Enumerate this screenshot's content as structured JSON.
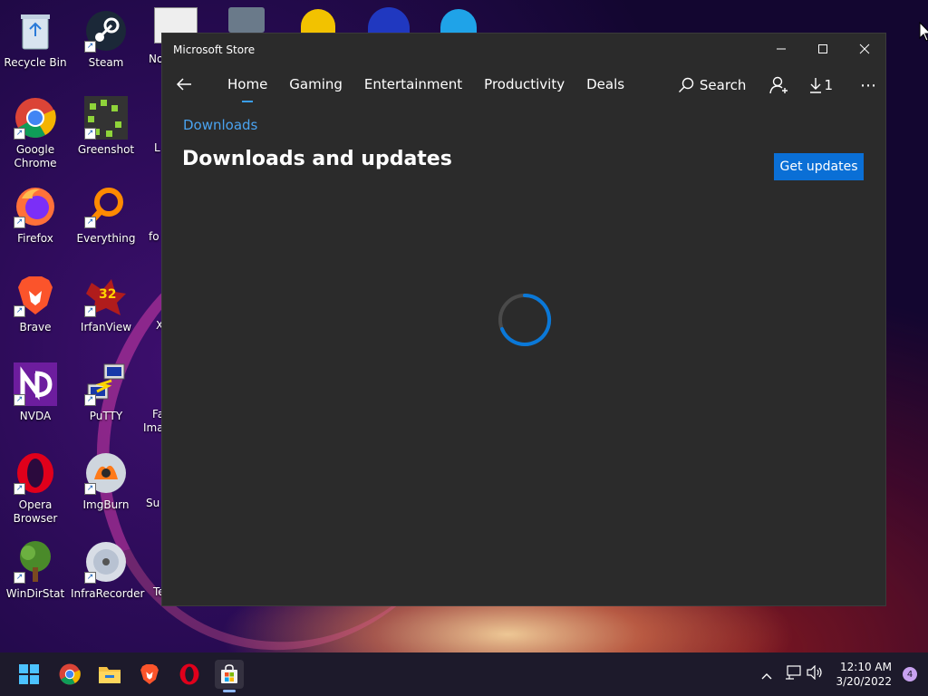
{
  "desktop": {
    "icons": [
      {
        "label": "Recycle Bin"
      },
      {
        "label": "Steam"
      },
      {
        "label": "Google Chrome"
      },
      {
        "label": "Greenshot"
      },
      {
        "label": "Firefox"
      },
      {
        "label": "Everything"
      },
      {
        "label": "Brave"
      },
      {
        "label": "IrfanView"
      },
      {
        "label": "NVDA"
      },
      {
        "label": "PuTTY"
      },
      {
        "label": "Opera Browser"
      },
      {
        "label": "ImgBurn"
      },
      {
        "label": "WinDirStat"
      },
      {
        "label": "InfraRecorder"
      }
    ],
    "partial_labels": [
      "No",
      "L",
      "fo",
      "X",
      "Fa",
      "Ima",
      "Su",
      "Te"
    ],
    "irfanview_badge": "32"
  },
  "window": {
    "title": "Microsoft Store",
    "controls": {
      "minimize": "—",
      "maximize": "☐",
      "close": "✕"
    },
    "nav": {
      "back": "←",
      "tabs": [
        {
          "label": "Home",
          "active": true
        },
        {
          "label": "Gaming"
        },
        {
          "label": "Entertainment"
        },
        {
          "label": "Productivity"
        },
        {
          "label": "Deals"
        }
      ],
      "search_label": "Search",
      "downloads_count": "1",
      "more": "⋯"
    },
    "breadcrumb": "Downloads",
    "page_title": "Downloads and updates",
    "get_updates_label": "Get updates"
  },
  "taskbar": {
    "clock_time": "12:10 AM",
    "clock_date": "3/20/2022",
    "notification_count": "4"
  },
  "colors": {
    "accent": "#0a6fd6",
    "link": "#4aa3f0",
    "window_bg": "#2b2b2b",
    "taskbar_bg": "#1d1a2b"
  }
}
